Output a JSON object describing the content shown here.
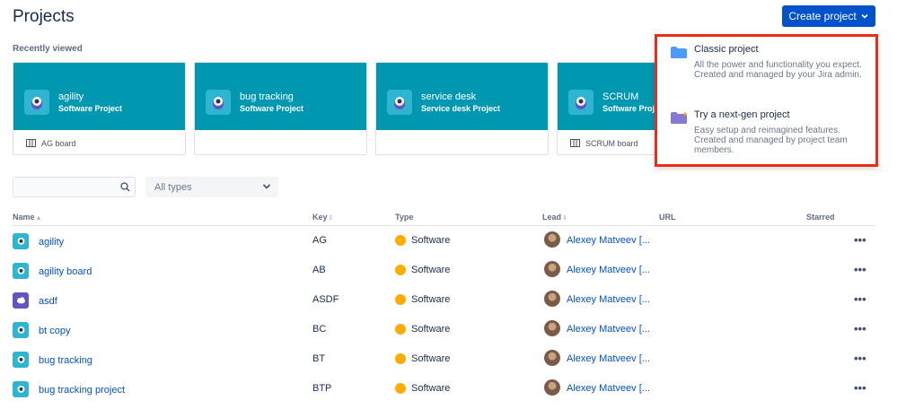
{
  "header": {
    "title": "Projects",
    "create_label": "Create project"
  },
  "recent": {
    "label": "Recently viewed",
    "cards": [
      {
        "name": "agility",
        "type": "Software Project",
        "footer": "AG board"
      },
      {
        "name": "bug tracking",
        "type": "Software Project",
        "footer": ""
      },
      {
        "name": "service desk",
        "type": "Service desk Project",
        "footer": ""
      },
      {
        "name": "SCRUM",
        "type": "Software Proj",
        "footer": "SCRUM board"
      }
    ]
  },
  "filters": {
    "search_placeholder": "",
    "type_selected": "All types"
  },
  "table": {
    "headers": {
      "name": "Name",
      "key": "Key",
      "type": "Type",
      "lead": "Lead",
      "url": "URL",
      "starred": "Starred"
    },
    "rows": [
      {
        "name": "agility",
        "key": "AG",
        "type": "Software",
        "lead": "Alexey Matveev [...",
        "icon": "robot"
      },
      {
        "name": "agility board",
        "key": "AB",
        "type": "Software",
        "lead": "Alexey Matveev [...",
        "icon": "robot"
      },
      {
        "name": "asdf",
        "key": "ASDF",
        "type": "Software",
        "lead": "Alexey Matveev [...",
        "icon": "cloud"
      },
      {
        "name": "bt copy",
        "key": "BC",
        "type": "Software",
        "lead": "Alexey Matveev [...",
        "icon": "robot"
      },
      {
        "name": "bug tracking",
        "key": "BT",
        "type": "Software",
        "lead": "Alexey Matveev [...",
        "icon": "robot"
      },
      {
        "name": "bug tracking project",
        "key": "BTP",
        "type": "Software",
        "lead": "Alexey Matveev [...",
        "icon": "robot"
      }
    ],
    "more_label": "•••"
  },
  "dropdown": {
    "classic": {
      "title": "Classic project",
      "desc": "All the power and functionality you expect. Created and managed by your Jira admin."
    },
    "nextgen": {
      "title": "Try a next-gen project",
      "desc": "Easy setup and reimagined features. Created and managed by project team members."
    }
  },
  "colors": {
    "accent": "#0052cc",
    "card_bg": "#0098b1",
    "highlight": "#ee2b16",
    "software_dot": "#ffab00"
  }
}
